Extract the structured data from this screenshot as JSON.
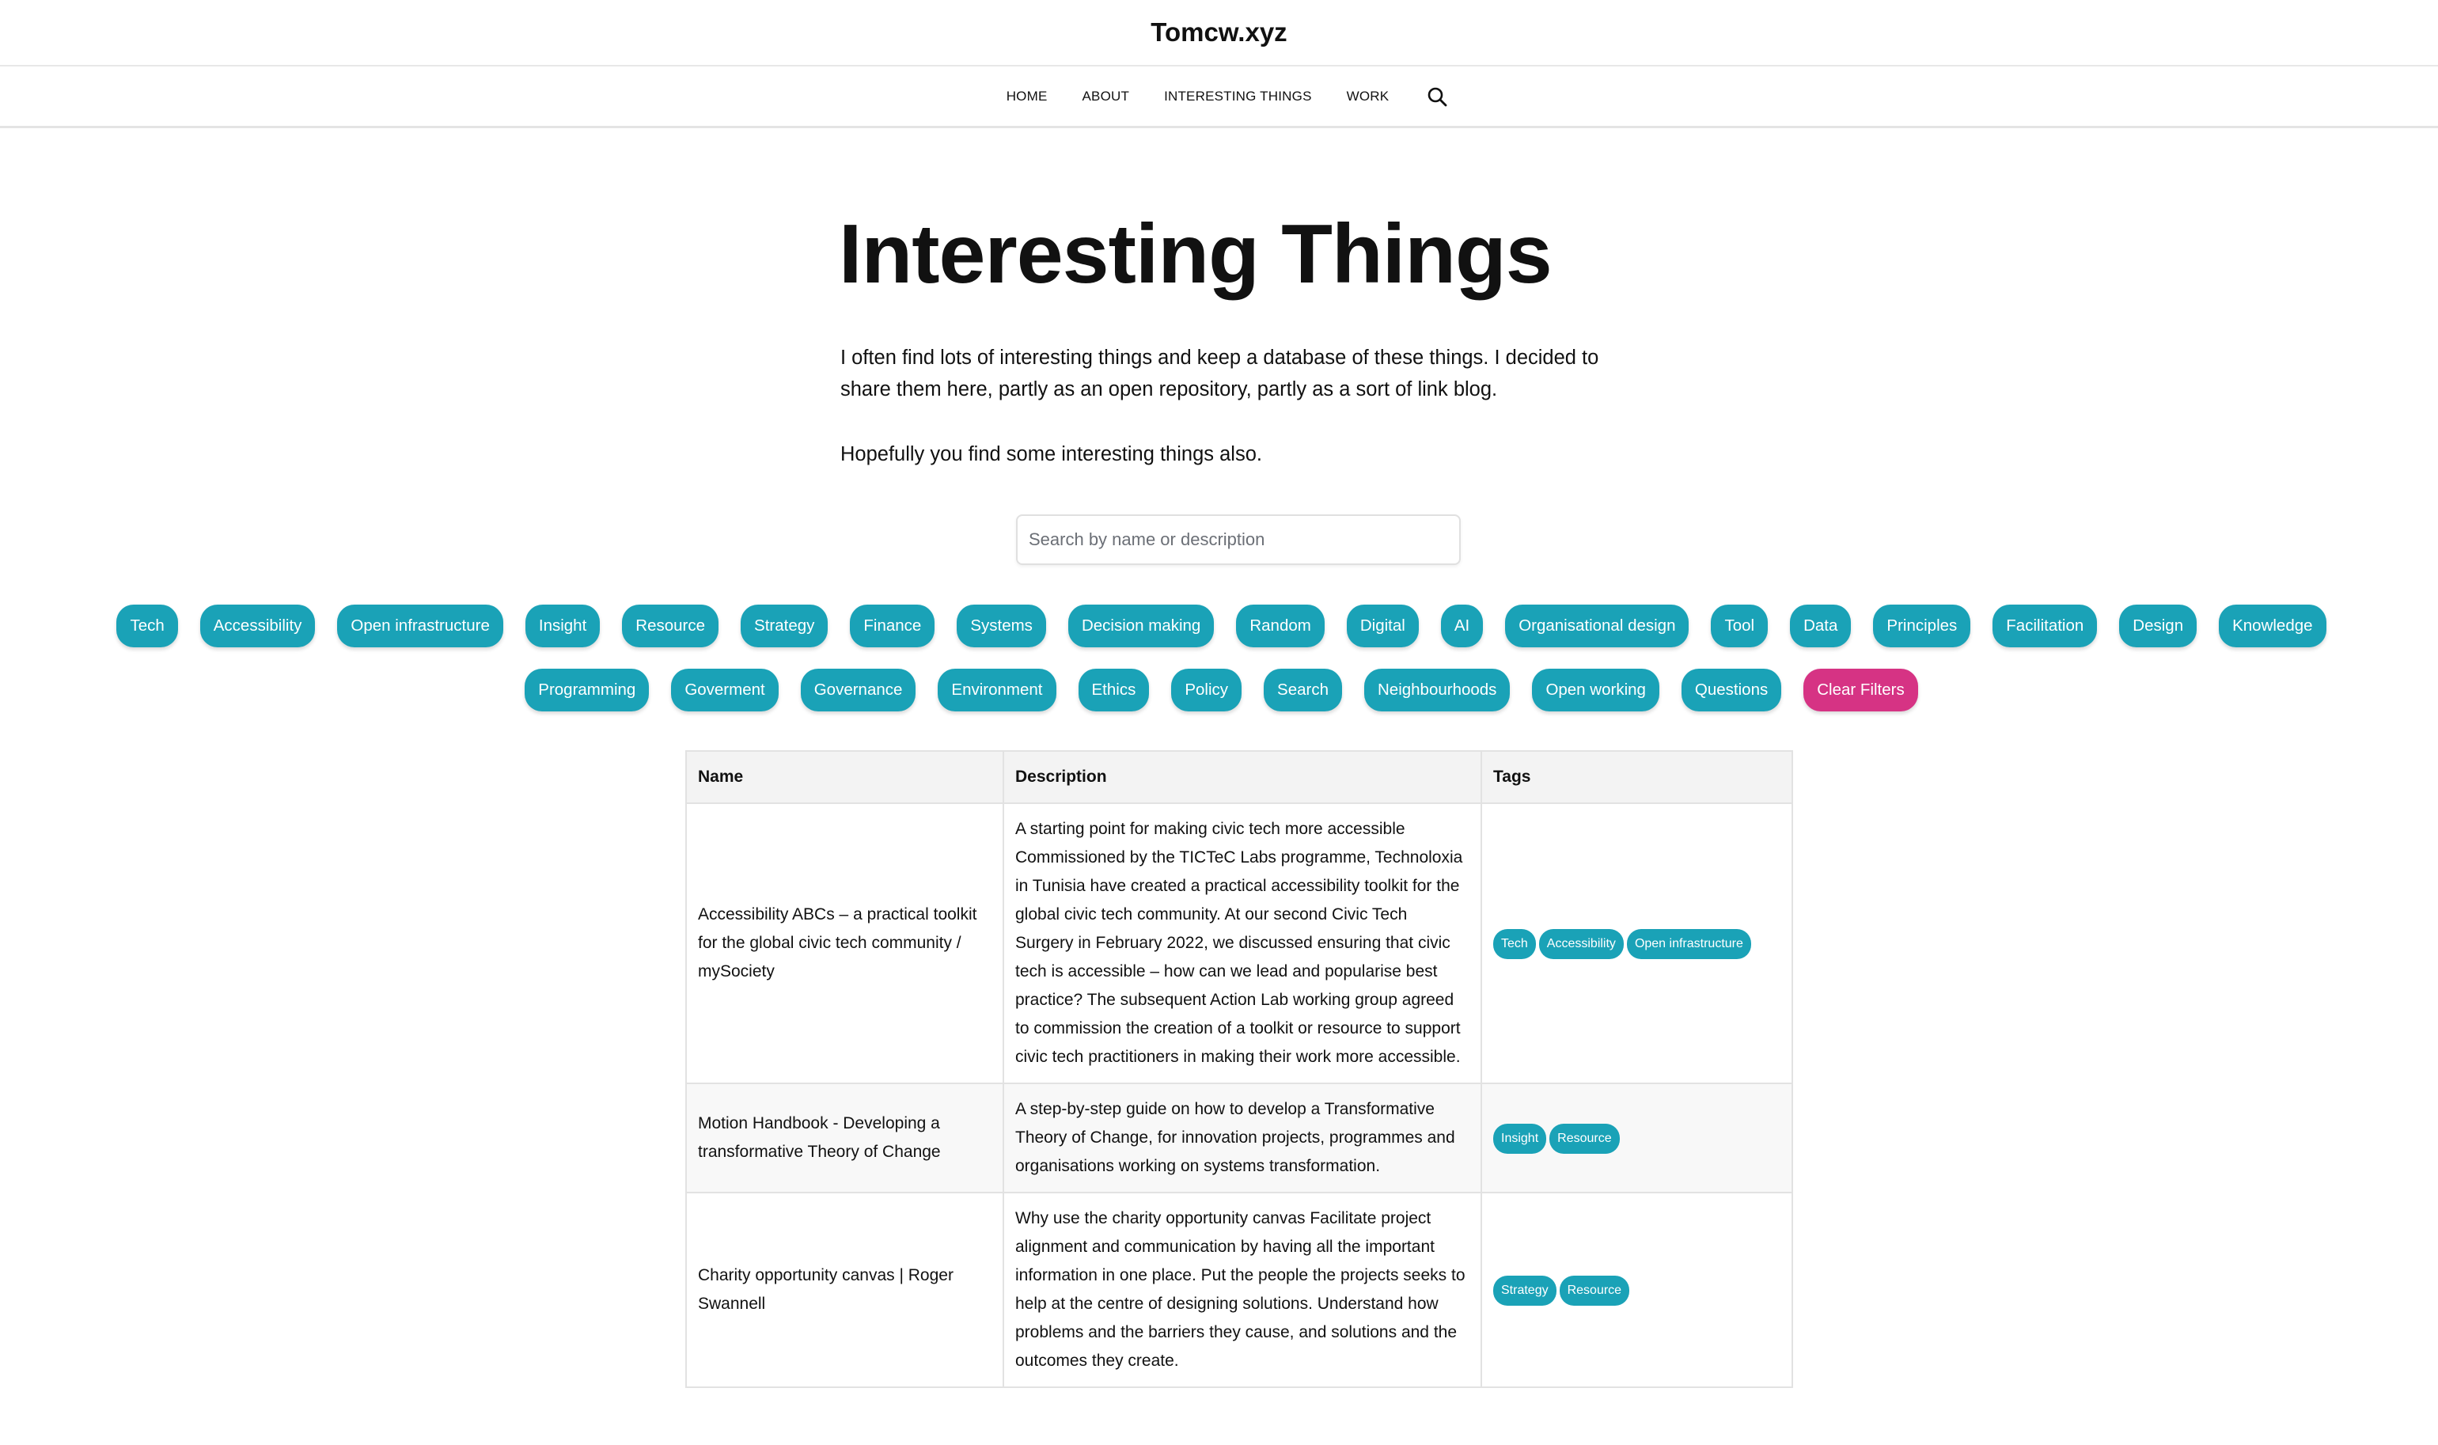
{
  "site": {
    "title": "Tomcw.xyz"
  },
  "nav": {
    "items": [
      {
        "label": "HOME"
      },
      {
        "label": "ABOUT"
      },
      {
        "label": "INTERESTING THINGS"
      },
      {
        "label": "WORK"
      }
    ],
    "search_icon": "search-icon"
  },
  "page": {
    "title": "Interesting Things",
    "intro_1": "I often find lots of interesting things and keep a database of these things. I decided to share them here, partly as an open repository, partly as a sort of link blog.",
    "intro_2": "Hopefully you find some interesting things also."
  },
  "search": {
    "placeholder": "Search by name or description",
    "value": ""
  },
  "filters": {
    "tags": [
      "Tech",
      "Accessibility",
      "Open infrastructure",
      "Insight",
      "Resource",
      "Strategy",
      "Finance",
      "Systems",
      "Decision making",
      "Random",
      "Digital",
      "AI",
      "Organisational design",
      "Tool",
      "Data",
      "Principles",
      "Facilitation",
      "Design",
      "Knowledge",
      "Programming",
      "Goverment",
      "Governance",
      "Environment",
      "Ethics",
      "Policy",
      "Search",
      "Neighbourhoods",
      "Open working",
      "Questions"
    ],
    "clear_label": "Clear Filters"
  },
  "colors": {
    "tag": "#1aa2b7",
    "clear": "#d63384"
  },
  "table": {
    "headers": [
      "Name",
      "Description",
      "Tags"
    ],
    "rows": [
      {
        "name": "Accessibility ABCs – a practical toolkit for the global civic tech community / mySociety",
        "description": "A starting point for making civic tech more accessible Commissioned by the TICTeC Labs programme, Technoloxia in Tunisia have created a practical accessibility toolkit for the global civic tech community. At our second Civic Tech Surgery in February 2022, we discussed ensuring that civic tech is accessible – how can we lead and popularise best practice? The subsequent Action Lab working group agreed to commission the creation of a toolkit or resource to support civic tech practitioners in making their work more accessible.",
        "tags": [
          "Tech",
          "Accessibility",
          "Open infrastructure"
        ]
      },
      {
        "name": "Motion Handbook - Developing a transformative Theory of Change",
        "description": "A step-by-step guide on how to develop a Transformative Theory of Change, for innovation projects, programmes and organisations working on systems transformation.",
        "tags": [
          "Insight",
          "Resource"
        ]
      },
      {
        "name": "Charity opportunity canvas | Roger Swannell",
        "description": "Why use the charity opportunity canvas Facilitate project alignment and communication by having all the important information in one place. Put the people the projects seeks to help at the centre of designing solutions. Understand how problems and the barriers they cause, and solutions and the outcomes they create.",
        "tags": [
          "Strategy",
          "Resource"
        ]
      }
    ]
  }
}
